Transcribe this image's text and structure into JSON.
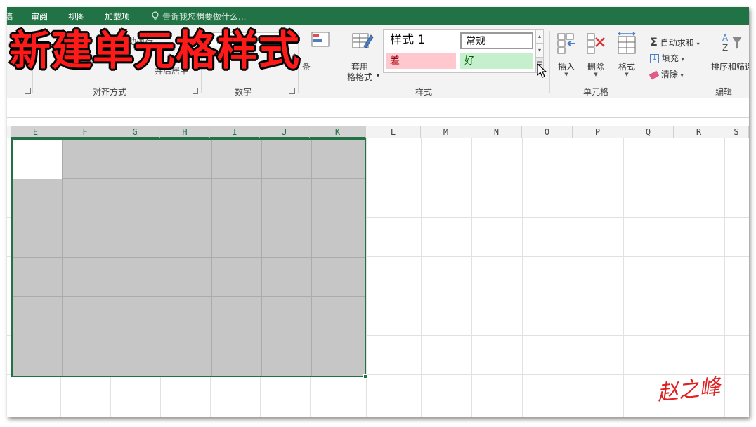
{
  "menu": {
    "tabs": [
      "稿",
      "审阅",
      "视图",
      "加载项"
    ],
    "tell_me": "告诉我您想要做什么..."
  },
  "ribbon": {
    "groups": {
      "alignment": "对齐方式",
      "number": "数字",
      "styles": "样式",
      "cells": "单元格",
      "editing": "编辑"
    },
    "partial": {
      "wrap": "动换行",
      "merge": "并后居中",
      "conditional": "条"
    },
    "table_format": {
      "line1": "套用",
      "line2": "格格式"
    },
    "styles_gallery": {
      "style1": "样式 1",
      "normal": "常规",
      "bad": "差",
      "good": "好"
    },
    "cells": {
      "insert": "插入",
      "delete": "删除",
      "format": "格式"
    },
    "editing": {
      "autosum": "自动求和",
      "fill": "填充",
      "clear": "清除",
      "sort_filter": "排序和筛选"
    }
  },
  "overlay": {
    "title": "新建单元格样式"
  },
  "grid": {
    "columns": [
      "E",
      "F",
      "G",
      "H",
      "I",
      "J",
      "K",
      "L",
      "M",
      "N",
      "O",
      "P",
      "Q",
      "R",
      "S"
    ]
  },
  "signature": "赵之峰",
  "colors": {
    "excel_green": "#217346",
    "bad_fill": "#ffc7ce",
    "bad_text": "#9c0006",
    "good_fill": "#c6efce",
    "good_text": "#006100",
    "selection_fill": "#c6c6c6",
    "title_red": "#ff1a1a"
  }
}
